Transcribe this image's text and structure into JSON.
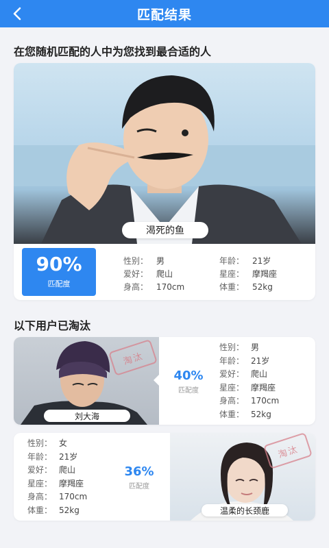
{
  "nav": {
    "title": "匹配结果",
    "back_icon": "chevron-left-icon"
  },
  "best": {
    "heading": "在您随机匹配的人中为您找到最合适的人",
    "name": "渴死的鱼",
    "match_percent": "90%",
    "match_label": "匹配度",
    "fields": {
      "gender_k": "性别：",
      "gender_v": "男",
      "age_k": "年龄：",
      "age_v": "21岁",
      "hobby_k": "爱好：",
      "hobby_v": "爬山",
      "sign_k": "星座：",
      "sign_v": "摩羯座",
      "height_k": "身高：",
      "height_v": "170cm",
      "weight_k": "体重：",
      "weight_v": "52kg"
    }
  },
  "eliminated": {
    "heading": "以下用户已淘汰",
    "stamp_text": "淘汰",
    "users": [
      {
        "name": "刘大海",
        "match_percent": "40%",
        "match_label": "匹配度",
        "fields": [
          {
            "k": "性别：",
            "v": "男"
          },
          {
            "k": "年龄：",
            "v": "21岁"
          },
          {
            "k": "爱好：",
            "v": "爬山"
          },
          {
            "k": "星座：",
            "v": "摩羯座"
          },
          {
            "k": "身高：",
            "v": "170cm"
          },
          {
            "k": "体重：",
            "v": "52kg"
          }
        ]
      },
      {
        "name": "温柔的长颈鹿",
        "match_percent": "36%",
        "match_label": "匹配度",
        "fields": [
          {
            "k": "性别：",
            "v": "女"
          },
          {
            "k": "年龄：",
            "v": "21岁"
          },
          {
            "k": "爱好：",
            "v": "爬山"
          },
          {
            "k": "星座：",
            "v": "摩羯座"
          },
          {
            "k": "身高：",
            "v": "170cm"
          },
          {
            "k": "体重：",
            "v": "52kg"
          }
        ]
      }
    ]
  },
  "colors": {
    "accent": "#2e87f0",
    "background": "#f2f3f7",
    "stamp": "#d7828c"
  }
}
